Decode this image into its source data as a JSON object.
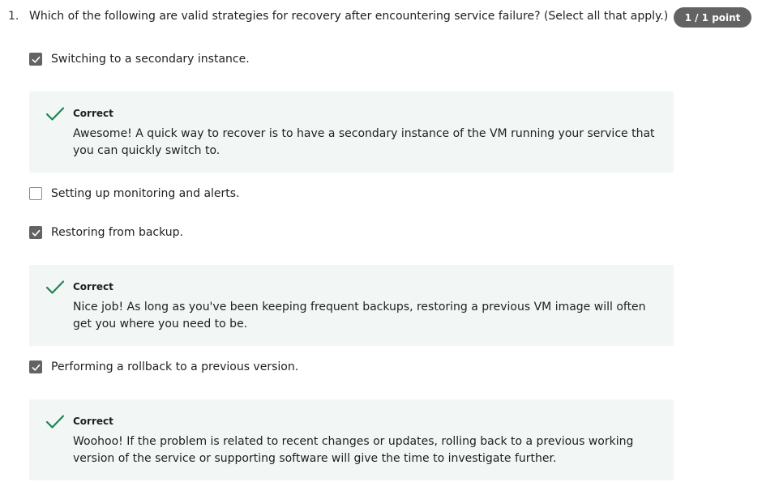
{
  "question": {
    "number": "1.",
    "text": "Which of the following are valid strategies for recovery after encountering service failure? (Select all that apply.)",
    "points": "1 / 1 point"
  },
  "options": [
    {
      "label": "Switching to a secondary instance.",
      "checked": true,
      "feedback": {
        "title": "Correct",
        "body": "Awesome! A quick way to recover is to have a secondary instance of the VM running your service that you can quickly switch to."
      }
    },
    {
      "label": "Setting up monitoring and alerts.",
      "checked": false
    },
    {
      "label": "Restoring from backup.",
      "checked": true,
      "feedback": {
        "title": "Correct",
        "body": "Nice job! As long as you've been keeping frequent backups, restoring a previous VM image will often get you where you need to be."
      }
    },
    {
      "label": "Performing a rollback to a previous version.",
      "checked": true,
      "feedback": {
        "title": "Correct",
        "body": "Woohoo! If the problem is related to recent changes or updates, rolling back to a previous working version of the service or supporting software will give the time to investigate further."
      }
    }
  ],
  "colors": {
    "correct_green": "#1f8354",
    "feedback_bg": "#f2f7f5",
    "badge_bg": "#636363"
  },
  "icons": {
    "checkbox_check": "check-mark-icon",
    "feedback_correct": "correct-check-icon"
  }
}
